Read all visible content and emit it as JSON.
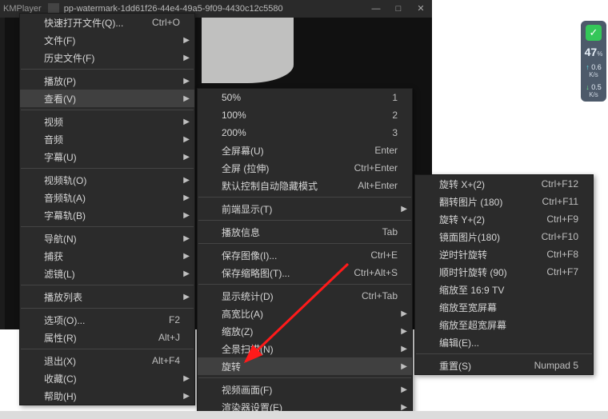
{
  "title": {
    "app": "KMPlayer",
    "file": "pp-watermark-1dd61f26-44e4-49a5-9f09-4430c12c5580"
  },
  "net": {
    "pct": "47",
    "pct_unit": "%",
    "down": "0.6",
    "down_u": "K/s",
    "up": "0.5",
    "up_u": "K/s"
  },
  "m1": {
    "g1": [
      {
        "l": "快速打开文件(Q)...",
        "s": "Ctrl+O"
      },
      {
        "l": "文件(F)",
        "sub": true
      },
      {
        "l": "历史文件(F)",
        "sub": true
      }
    ],
    "g2": [
      {
        "l": "播放(P)",
        "sub": true
      },
      {
        "l": "查看(V)",
        "sub": true,
        "sel": true
      }
    ],
    "g3": [
      {
        "l": "视频",
        "sub": true
      },
      {
        "l": "音频",
        "sub": true
      },
      {
        "l": "字幕(U)",
        "sub": true
      }
    ],
    "g4": [
      {
        "l": "视频轨(O)",
        "sub": true
      },
      {
        "l": "音频轨(A)",
        "sub": true
      },
      {
        "l": "字幕轨(B)",
        "sub": true
      }
    ],
    "g5": [
      {
        "l": "导航(N)",
        "sub": true
      },
      {
        "l": "捕获",
        "sub": true
      },
      {
        "l": "滤镜(L)",
        "sub": true
      }
    ],
    "g6": [
      {
        "l": "播放列表",
        "sub": true
      }
    ],
    "g7": [
      {
        "l": "选项(O)...",
        "s": "F2"
      },
      {
        "l": "属性(R)",
        "s": "Alt+J"
      }
    ],
    "g8": [
      {
        "l": "退出(X)",
        "s": "Alt+F4"
      },
      {
        "l": "收藏(C)",
        "sub": true
      },
      {
        "l": "帮助(H)",
        "sub": true
      }
    ]
  },
  "m2": {
    "g1": [
      {
        "l": "50%",
        "s": "1"
      },
      {
        "l": "100%",
        "s": "2"
      },
      {
        "l": "200%",
        "s": "3"
      },
      {
        "l": "全屏幕(U)",
        "s": "Enter"
      },
      {
        "l": "全屏 (拉伸)",
        "s": "Ctrl+Enter"
      },
      {
        "l": "默认控制自动隐藏模式",
        "s": "Alt+Enter"
      }
    ],
    "g2": [
      {
        "l": "前端显示(T)",
        "sub": true
      }
    ],
    "g3": [
      {
        "l": "播放信息",
        "s": "Tab"
      }
    ],
    "g4": [
      {
        "l": "保存图像(I)...",
        "s": "Ctrl+E"
      },
      {
        "l": "保存缩略图(T)...",
        "s": "Ctrl+Alt+S"
      }
    ],
    "g5": [
      {
        "l": "显示统计(D)",
        "s": "Ctrl+Tab"
      },
      {
        "l": "高宽比(A)",
        "sub": true
      },
      {
        "l": "缩放(Z)",
        "sub": true
      },
      {
        "l": "全景扫描(N)",
        "sub": true
      },
      {
        "l": "旋转",
        "sub": true,
        "sel": true
      }
    ],
    "g6": [
      {
        "l": "视频画面(F)",
        "sub": true
      },
      {
        "l": "渲染器设置(E)",
        "sub": true
      }
    ]
  },
  "m3": {
    "g1": [
      {
        "l": "旋转 X+(2)",
        "s": "Ctrl+F12"
      },
      {
        "l": "翻转图片  (180)",
        "s": "Ctrl+F11"
      },
      {
        "l": "旋转 Y+(2)",
        "s": "Ctrl+F9"
      },
      {
        "l": "镜面图片(180)",
        "s": "Ctrl+F10"
      },
      {
        "l": "逆时针旋转",
        "s": "Ctrl+F8"
      },
      {
        "l": "顺时针旋转  (90)",
        "s": "Ctrl+F7"
      },
      {
        "l": "缩放至 16:9 TV"
      },
      {
        "l": "缩放至宽屏幕"
      },
      {
        "l": "缩放至超宽屏幕"
      },
      {
        "l": "编辑(E)..."
      }
    ],
    "g2": [
      {
        "l": "重置(S)",
        "s": "Numpad 5"
      }
    ]
  }
}
